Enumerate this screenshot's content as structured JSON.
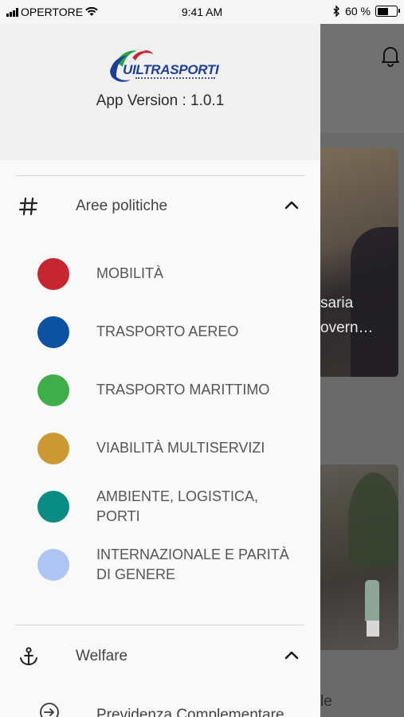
{
  "status_bar": {
    "carrier": "OPERTORE",
    "time": "9:41 AM",
    "battery_percent": "60 %",
    "battery_level": 0.6
  },
  "drawer": {
    "logo_text": "UILTRASPORTI",
    "app_version": "App Version : 1.0.1",
    "sections": [
      {
        "icon": "hash-icon",
        "label": "Aree politiche",
        "expanded": true,
        "items": [
          {
            "label": "MOBILITÀ",
            "color": "#c6262f"
          },
          {
            "label": "TRASPORTO AEREO",
            "color": "#0b52a3"
          },
          {
            "label": "TRASPORTO MARITTIMO",
            "color": "#3fae49"
          },
          {
            "label": "VIABILITÀ MULTISERVIZI",
            "color": "#cc9a35"
          },
          {
            "label": "AMBIENTE, LOGISTICA, PORTI",
            "color": "#098c84"
          },
          {
            "label": "INTERNAZIONALE E PARITÀ DI GENERE",
            "color": "#aec5f4"
          }
        ]
      },
      {
        "icon": "anchor-icon",
        "label": "Welfare",
        "expanded": true,
        "items": [
          {
            "label": "Previdenza Complementare",
            "icon": "arrow-right-circle-icon"
          }
        ]
      }
    ]
  },
  "background": {
    "card1_text_line1": "saria",
    "card1_text_line2": "overn…",
    "bottom_text": "le"
  }
}
